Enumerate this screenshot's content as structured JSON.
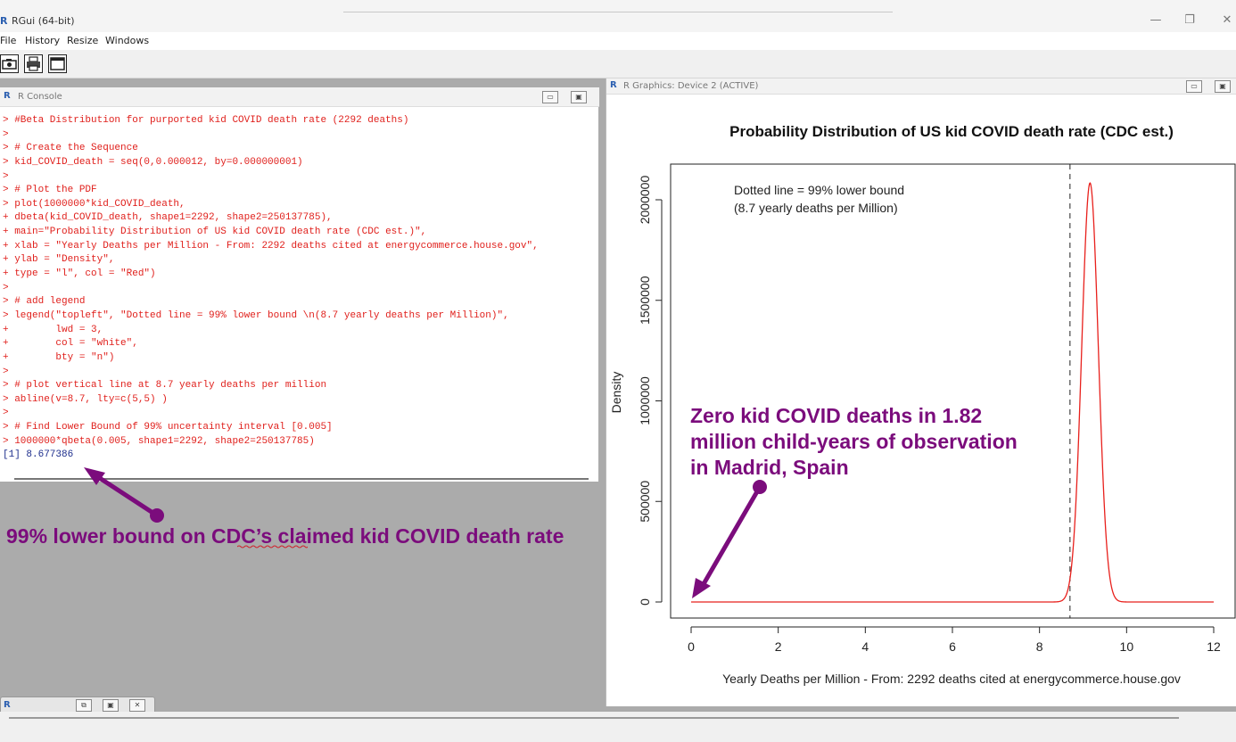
{
  "window": {
    "title": "RGui (64-bit)",
    "minimize": "—",
    "restore": "❐",
    "close": "✕"
  },
  "menu": [
    "File",
    "History",
    "Resize",
    "Windows"
  ],
  "toolbar": {
    "icons": [
      "camera-icon",
      "printer-icon",
      "window-icon"
    ]
  },
  "console": {
    "title": "R Console",
    "lines": [
      "> #Beta Distribution for purported kid COVID death rate (2292 deaths)",
      ">",
      "> # Create the Sequence",
      "> kid_COVID_death = seq(0,0.000012, by=0.000000001)",
      ">",
      "> # Plot the PDF",
      "> plot(1000000*kid_COVID_death,",
      "+ dbeta(kid_COVID_death, shape1=2292, shape2=250137785),",
      "+ main=\"Probability Distribution of US kid COVID death rate (CDC est.)\",",
      "+ xlab = \"Yearly Deaths per Million - From: 2292 deaths cited at energycommerce.house.gov\",",
      "+ ylab = \"Density\",",
      "+ type = \"l\", col = \"Red\")",
      ">",
      "> # add legend",
      "> legend(\"topleft\", \"Dotted line = 99% lower bound \\n(8.7 yearly deaths per Million)\",",
      "+        lwd = 3,",
      "+        col = \"white\",",
      "+        bty = \"n\")",
      ">",
      "> # plot vertical line at 8.7 yearly deaths per million",
      "> abline(v=8.7, lty=c(5,5) )",
      ">",
      "> # Find Lower Bound of 99% uncertainty interval [0.005]",
      "> 1000000*qbeta(0.005, shape1=2292, shape2=250137785)",
      "[1] 8.677386"
    ]
  },
  "graphics": {
    "title": "R Graphics: Device 2 (ACTIVE)"
  },
  "chart_data": {
    "type": "line",
    "title": "Probability Distribution of US kid COVID death rate (CDC est.)",
    "xlabel": "Yearly Deaths per Million - From: 2292 deaths cited at energycommerce.house.gov",
    "ylabel": "Density",
    "xlim": [
      0,
      12
    ],
    "ylim": [
      0,
      2100000
    ],
    "x_ticks": [
      0,
      2,
      4,
      6,
      8,
      10,
      12
    ],
    "y_ticks": [
      0,
      500000,
      1000000,
      1500000,
      2000000
    ],
    "x_tick_labels": [
      "0",
      "2",
      "4",
      "6",
      "8",
      "10",
      "12"
    ],
    "y_tick_labels": [
      "0",
      "500000",
      "1000000",
      "1500000",
      "2000000"
    ],
    "series_color": "#e8201c",
    "distribution": {
      "family": "beta-scaled",
      "mean": 9.16,
      "sd": 0.1913,
      "scale": 1000000
    },
    "vline": {
      "x": 8.7,
      "style": "dashed"
    },
    "legend_lines": [
      "Dotted line = 99% lower bound",
      "(8.7 yearly deaths per Million)"
    ],
    "legend_position": "top-left",
    "grid": false
  },
  "annotations": {
    "left": "99% lower bound on CDC’s claimed kid COVID death rate",
    "right": "Zero kid COVID deaths in 1.82\nmillion child-years of observation\nin Madrid, Spain",
    "color": "#7b0c7c"
  }
}
